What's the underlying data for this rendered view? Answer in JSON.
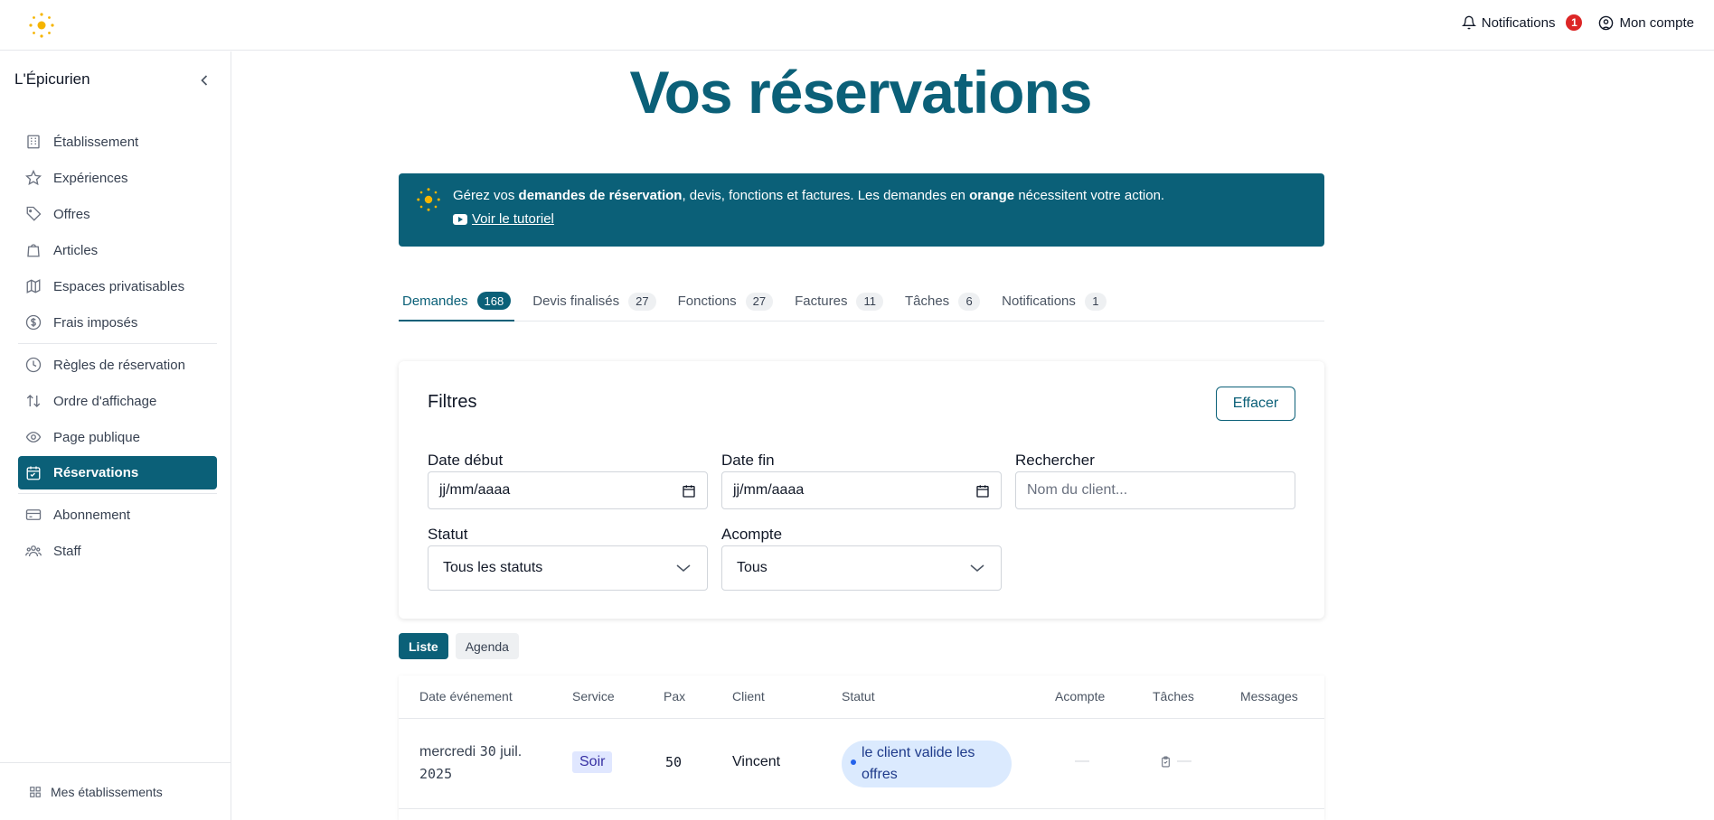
{
  "colors": {
    "brand": "#0b6078",
    "sun": "#f5b400",
    "badge_red": "#dc2626",
    "status_blue": "#dbeafe"
  },
  "topbar": {
    "notifications_label": "Notifications",
    "notifications_count": "1",
    "account_label": "Mon compte"
  },
  "sidebar": {
    "title": "L'Épicurien",
    "items": [
      {
        "label": "Établissement",
        "icon": "building-icon"
      },
      {
        "label": "Expériences",
        "icon": "star-icon"
      },
      {
        "label": "Offres",
        "icon": "tag-icon"
      },
      {
        "label": "Articles",
        "icon": "shopping-bag-icon"
      },
      {
        "label": "Espaces privatisables",
        "icon": "map-icon"
      },
      {
        "label": "Frais imposés",
        "icon": "dollar-circle-icon"
      },
      {
        "label": "Règles de réservation",
        "icon": "clock-icon"
      },
      {
        "label": "Ordre d'affichage",
        "icon": "sort-arrows-icon"
      },
      {
        "label": "Page publique",
        "icon": "eye-icon"
      },
      {
        "label": "Réservations",
        "icon": "calendar-icon",
        "active": true
      },
      {
        "label": "Abonnement",
        "icon": "credit-card-icon"
      },
      {
        "label": "Staff",
        "icon": "users-icon"
      }
    ],
    "footer_label": "Mes établissements"
  },
  "main": {
    "title": "Vos réservations",
    "banner": {
      "text_1": "Gérez vos ",
      "bold_1": "demandes de réservation",
      "text_2": ", devis, fonctions et factures. Les demandes en ",
      "bold_2": "orange",
      "text_3": " nécessitent votre action.",
      "link": "Voir le tutoriel"
    },
    "tabs": [
      {
        "label": "Demandes",
        "count": "168",
        "active": true
      },
      {
        "label": "Devis finalisés",
        "count": "27"
      },
      {
        "label": "Fonctions",
        "count": "27"
      },
      {
        "label": "Factures",
        "count": "11"
      },
      {
        "label": "Tâches",
        "count": "6"
      },
      {
        "label": "Notifications",
        "count": "1"
      }
    ],
    "filters": {
      "title": "Filtres",
      "clear_label": "Effacer",
      "date_start_label": "Date début",
      "date_start_value": "jj/mm/aaaa",
      "date_end_label": "Date fin",
      "date_end_value": "jj/mm/aaaa",
      "search_label": "Rechercher",
      "search_placeholder": "Nom du client...",
      "status_label": "Statut",
      "status_value": "Tous les statuts",
      "deposit_label": "Acompte",
      "deposit_value": "Tous"
    },
    "view_toggle": {
      "list": "Liste",
      "agenda": "Agenda"
    },
    "table": {
      "headers": {
        "date": "Date événement",
        "service": "Service",
        "pax": "Pax",
        "client": "Client",
        "status": "Statut",
        "deposit": "Acompte",
        "tasks": "Tâches",
        "messages": "Messages"
      },
      "rows": [
        {
          "date_day": "mercredi ",
          "date_num": "30",
          "date_month": " juil.",
          "date_year": "2025",
          "service": "Soir",
          "pax": "50",
          "client": "Vincent",
          "status": "le client valide les offres",
          "deposit": "—",
          "tasks": "—"
        }
      ]
    }
  }
}
